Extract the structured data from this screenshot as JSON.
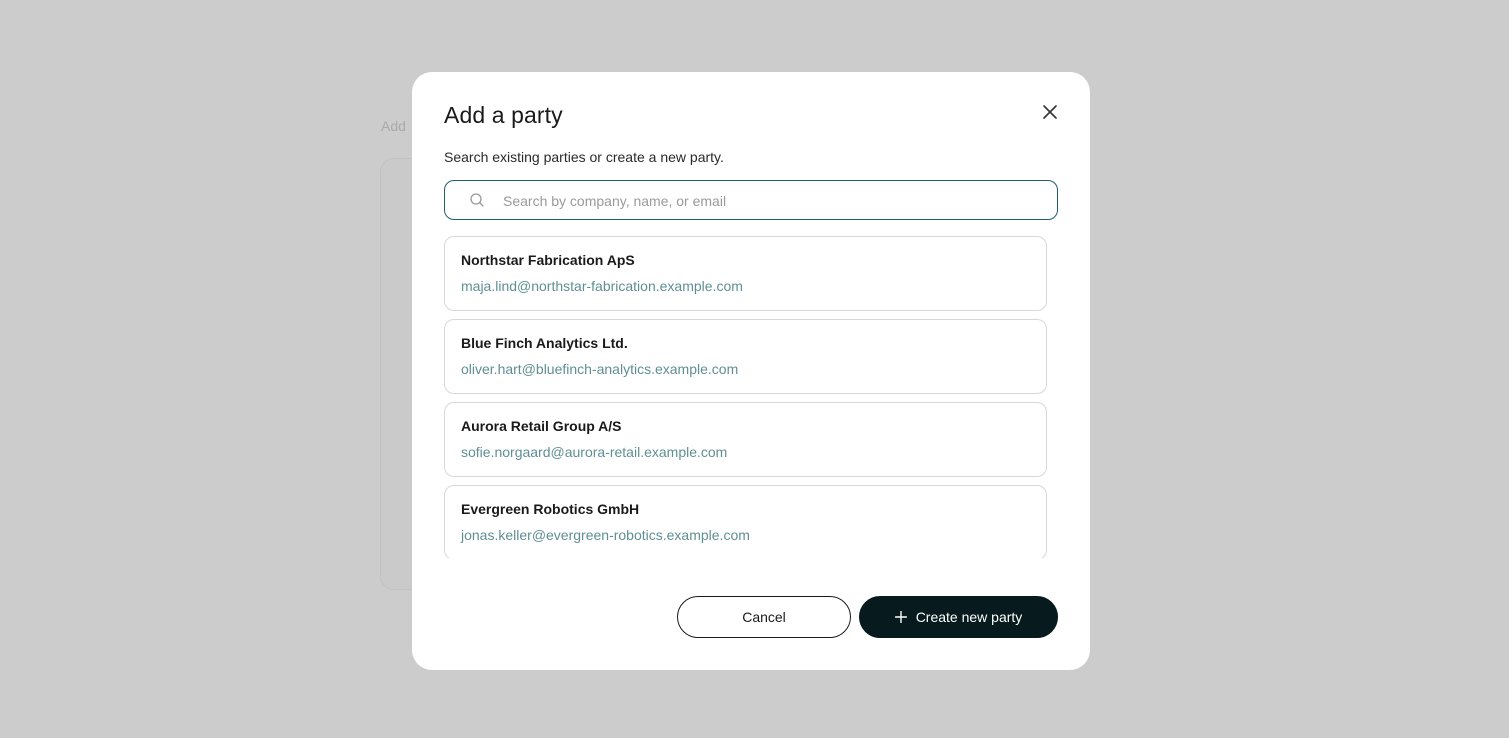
{
  "background": {
    "partial_label": "Add"
  },
  "modal": {
    "title": "Add a party",
    "subtitle": "Search existing parties or create a new party.",
    "close_icon": "close-icon"
  },
  "search": {
    "placeholder": "Search by company, name, or email",
    "value": "",
    "icon": "search-icon"
  },
  "results": [
    {
      "name": "Northstar Fabrication ApS",
      "email": "maja.lind@northstar-fabrication.example.com"
    },
    {
      "name": "Blue Finch Analytics Ltd.",
      "email": "oliver.hart@bluefinch-analytics.example.com"
    },
    {
      "name": "Aurora Retail Group A/S",
      "email": "sofie.norgaard@aurora-retail.example.com"
    },
    {
      "name": "Evergreen Robotics GmbH",
      "email": "jonas.keller@evergreen-robotics.example.com"
    }
  ],
  "actions": {
    "cancel_label": "Cancel",
    "create_label": "Create new party",
    "create_icon": "plus-icon"
  },
  "colors": {
    "overlay": "#cccccc",
    "primary_button": "#071a1d",
    "email_text": "#5f8f94",
    "search_border": "#1f5f6b"
  }
}
